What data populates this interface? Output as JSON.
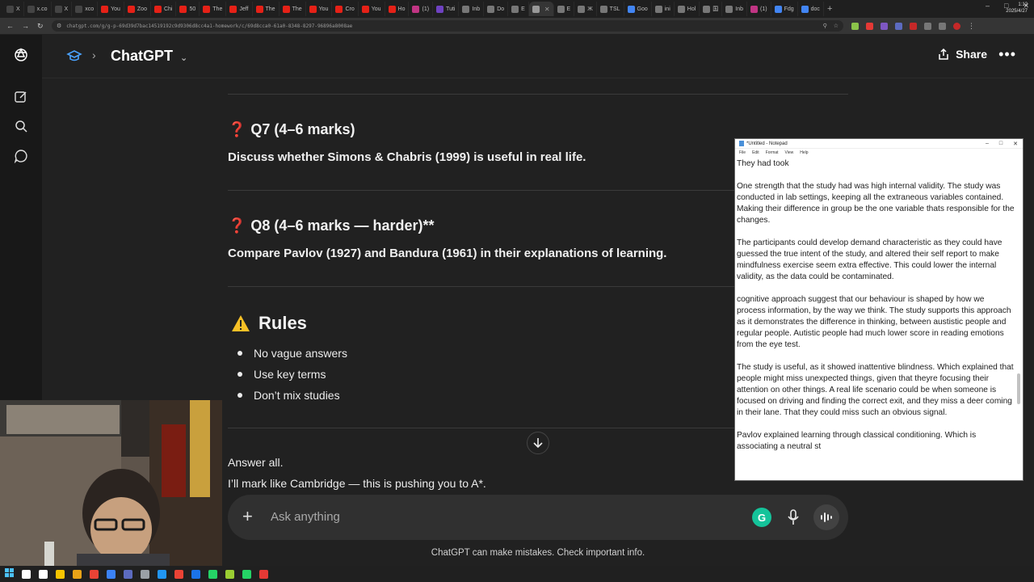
{
  "browser": {
    "tabs": [
      {
        "label": "X",
        "color": "#444"
      },
      {
        "label": "x.co",
        "color": "#444"
      },
      {
        "label": "X",
        "color": "#444"
      },
      {
        "label": "xco",
        "color": "#444"
      },
      {
        "label": "You",
        "color": "#e62117"
      },
      {
        "label": "Zoo",
        "color": "#e62117"
      },
      {
        "label": "Chi",
        "color": "#e62117"
      },
      {
        "label": "50",
        "color": "#e62117"
      },
      {
        "label": "The",
        "color": "#e62117"
      },
      {
        "label": "Jeff",
        "color": "#e62117"
      },
      {
        "label": "The",
        "color": "#e62117"
      },
      {
        "label": "The",
        "color": "#e62117"
      },
      {
        "label": "You",
        "color": "#e62117"
      },
      {
        "label": "Cro",
        "color": "#e62117"
      },
      {
        "label": "You",
        "color": "#e62117"
      },
      {
        "label": "Ho",
        "color": "#e62117"
      },
      {
        "label": "(1)",
        "color": "#c13584"
      },
      {
        "label": "Tuti",
        "color": "#6f42c1"
      },
      {
        "label": "Inb",
        "color": "#777"
      },
      {
        "label": "Do",
        "color": "#777"
      },
      {
        "label": "Ε",
        "color": "#777"
      },
      {
        "label": "",
        "color": "#999",
        "active": true
      },
      {
        "label": "Ε",
        "color": "#777"
      },
      {
        "label": "Ж",
        "color": "#777"
      },
      {
        "label": "TSL",
        "color": "#777"
      },
      {
        "label": "Goo",
        "color": "#4285f4"
      },
      {
        "label": "ini",
        "color": "#777"
      },
      {
        "label": "Hol",
        "color": "#777"
      },
      {
        "label": "国",
        "color": "#777"
      },
      {
        "label": "Inb",
        "color": "#777"
      },
      {
        "label": "(1)",
        "color": "#c13584"
      },
      {
        "label": "Fdg",
        "color": "#4285f4"
      },
      {
        "label": "doc",
        "color": "#4285f4"
      }
    ],
    "new_tab": "+",
    "url": "chatgpt.com/g/g-p-69d39d7bac14519192c9d9306d8cc4a1-homework/c/69d8cca0-61a0-8348-8297-96896a8008ae"
  },
  "header": {
    "title": "ChatGPT",
    "share_label": "Share",
    "more_label": "•••"
  },
  "chat": {
    "q7_title": "Q7 (4–6 marks)",
    "q7_body": "Discuss whether Simons & Chabris (1999) is useful in real life.",
    "q8_title": "Q8 (4–6 marks — harder)**",
    "q8_body": "Compare Pavlov (1927) and Bandura (1961) in their explanations of learning.",
    "rules_title": "Rules",
    "rules": [
      "No vague answers",
      "Use key terms",
      "Don’t mix studies"
    ],
    "answer_all": "Answer all.",
    "mark_line": "I’ll mark like Cambridge — this is pushing you to A*."
  },
  "composer": {
    "placeholder": "Ask anything",
    "grammarly": "G"
  },
  "disclaimer": "ChatGPT can make mistakes. Check important info.",
  "notepad": {
    "title": "*Untitled - Notepad",
    "menu": [
      "File",
      "Edit",
      "Format",
      "View",
      "Help"
    ],
    "paragraphs": [
      "They had took",
      "One strength that the study had was high internal validity. The study was conducted in lab settings, keeping all the extraneous variables contained. Making their difference in group be the one variable thats responsible for the changes.",
      "The participants could develop demand characteristic as they could have guessed the true intent of the study, and altered their self report to make mindfulness exercise seem extra effective. This could lower the internal validity, as the data could be contaminated.",
      "cognitive approach suggest that our behaviour is shaped by how we process information, by the way we think. The study supports this approach as it demonstrates the difference in thinking, between austistic people and regular people. Autistic people had much lower score in reading emotions from the eye test.",
      "The study is useful, as it showed inattentive blindness. Which explained that people might miss unexpected things, given that theyre focusing their attention on other things. A real life scenario could be when someone is focused on driving and finding the correct exit, and they miss a deer coming in their lane. That they could miss such an obvious signal.",
      "Pavlov explained learning through classical conditioning. Which is associating a neutral st"
    ]
  },
  "taskbar": {
    "clock_time": "1:12",
    "clock_date": "2025/4/27",
    "icon_colors": [
      "#fff",
      "#fff",
      "#fff",
      "#f5c400",
      "#e8a317",
      "#ea4335",
      "#3b82f6",
      "#5c6bc0",
      "#9aa0a6",
      "#2196f3",
      "#ea4335",
      "#1b73e8",
      "#25d366",
      "#9acd32",
      "#25d366",
      "#e53935"
    ]
  }
}
